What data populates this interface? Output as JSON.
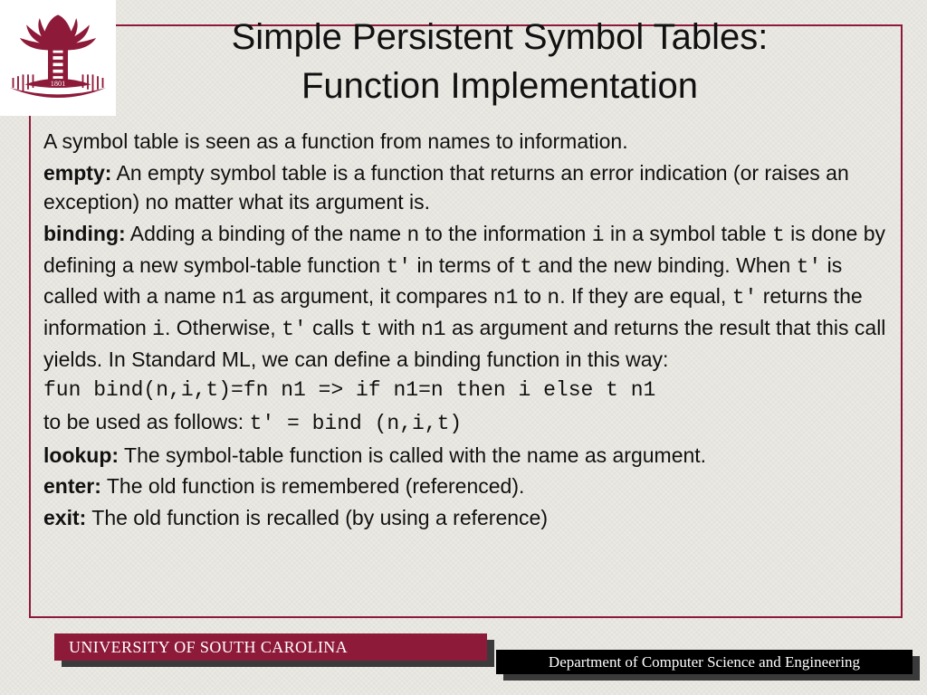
{
  "title": {
    "line1": "Simple Persistent Symbol Tables:",
    "line2": "Function Implementation"
  },
  "intro": "A symbol table is seen as a function from names to information.",
  "items": {
    "empty": {
      "label": "empty:",
      "text": " An empty symbol table is a function that returns an error indication (or raises an exception) no matter what its argument is."
    },
    "binding": {
      "label": "binding:",
      "t1": " Adding a binding of the name ",
      "n": "n",
      "t2": " to the information ",
      "i": "i",
      "t3": " in a symbol table ",
      "tvar": "t",
      "t4": " is done by defining a new symbol-table function ",
      "tp": "t'",
      "t5": " in terms of ",
      "t6": " and the new binding. When ",
      "t7": " is called with a name ",
      "n1": "n1",
      "t8": " as argument, it compares ",
      "t9": " to ",
      "t10": ". If they are equal, ",
      "t11": " returns the information ",
      "t12": ". Otherwise, ",
      "t13": " calls ",
      "t14": " with ",
      "t15": " as argument and returns the result that this call yields. In Standard ML, we can define a binding function in this way:"
    },
    "code": "fun bind(n,i,t)=fn n1 => if n1=n then i else t n1",
    "usage": {
      "t1": "to be used as follows: ",
      "code": "t' = bind (n,i,t)"
    },
    "lookup": {
      "label": "lookup:",
      "text": " The symbol-table function is called with the name as argument."
    },
    "enter": {
      "label": "enter:",
      "text": " The old function is remembered (referenced)."
    },
    "exit": {
      "label": "exit:",
      "text": " The old function is recalled (by using a reference)"
    }
  },
  "footer": {
    "university": "UNIVERSITY OF SOUTH CAROLINA",
    "department": "Department of Computer Science and Engineering"
  },
  "logo": {
    "year": "1801"
  }
}
